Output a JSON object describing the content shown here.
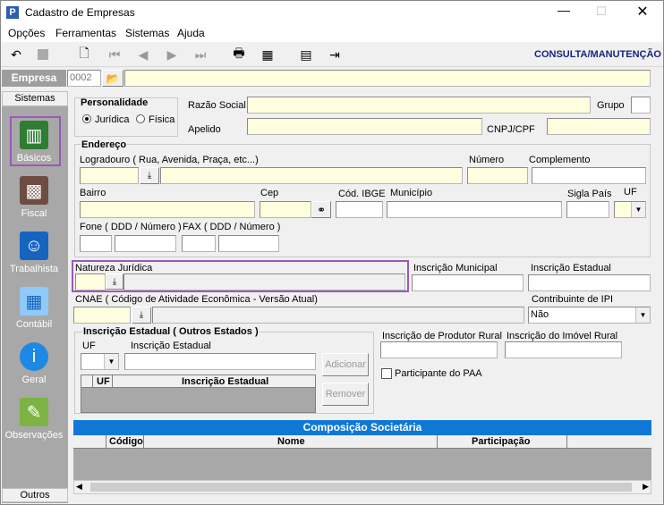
{
  "window": {
    "title": "Cadastro de Empresas",
    "app_icon": "P"
  },
  "menu": [
    "Opções",
    "Ferramentas",
    "Sistemas",
    "Ajuda"
  ],
  "toolbar": {
    "mode_label": "CONSULTA/MANUTENÇÃO"
  },
  "empresa": {
    "label": "Empresa",
    "code": "0002"
  },
  "sidebar": {
    "header": "Sistemas",
    "items": [
      {
        "label": "Básicos",
        "icon": "book-icon"
      },
      {
        "label": "Fiscal",
        "icon": "calculator-icon"
      },
      {
        "label": "Trabalhista",
        "icon": "worker-icon"
      },
      {
        "label": "Contábil",
        "icon": "spreadsheet-icon"
      },
      {
        "label": "Geral",
        "icon": "info-icon"
      },
      {
        "label": "Observações",
        "icon": "notes-icon"
      }
    ],
    "footer": "Outros"
  },
  "personalidade": {
    "title": "Personalidade",
    "opt1": "Jurídica",
    "opt2": "Física"
  },
  "labels": {
    "razao_social": "Razão Social",
    "grupo": "Grupo",
    "apelido": "Apelido",
    "cnpj": "CNPJ/CPF",
    "endereco": "Endereço",
    "logradouro": "Logradouro ( Rua, Avenida, Praça, etc...)",
    "numero": "Número",
    "complemento": "Complemento",
    "bairro": "Bairro",
    "cep": "Cep",
    "cod_ibge": "Cód. IBGE",
    "municipio": "Município",
    "sigla_pais": "Sigla País",
    "uf": "UF",
    "fone": "Fone ( DDD / Número )",
    "fax": "FAX ( DDD / Número )",
    "natureza": "Natureza Jurídica",
    "insc_municipal": "Inscrição Municipal",
    "insc_estadual": "Inscrição Estadual",
    "cnae": "CNAE ( Código de Atividade Econômica - Versão Atual)",
    "contrib_ipi": "Contribuinte de IPI",
    "ie_outros": "Inscrição Estadual ( Outros Estados )",
    "ie_uf": "UF",
    "ie_insc": "Inscrição Estadual",
    "ie_col_uf": "UF",
    "ie_col_insc": "Inscrição Estadual",
    "adicionar": "Adicionar",
    "remover": "Remover",
    "prod_rural": "Inscrição de Produtor Rural",
    "imovel_rural": "Inscrição do Imóvel Rural",
    "paa": "Participante do PAA"
  },
  "values": {
    "contrib_ipi": "Não"
  },
  "composicao": {
    "title": "Composição Societária",
    "cols": [
      "Código",
      "Nome",
      "Participação"
    ]
  }
}
